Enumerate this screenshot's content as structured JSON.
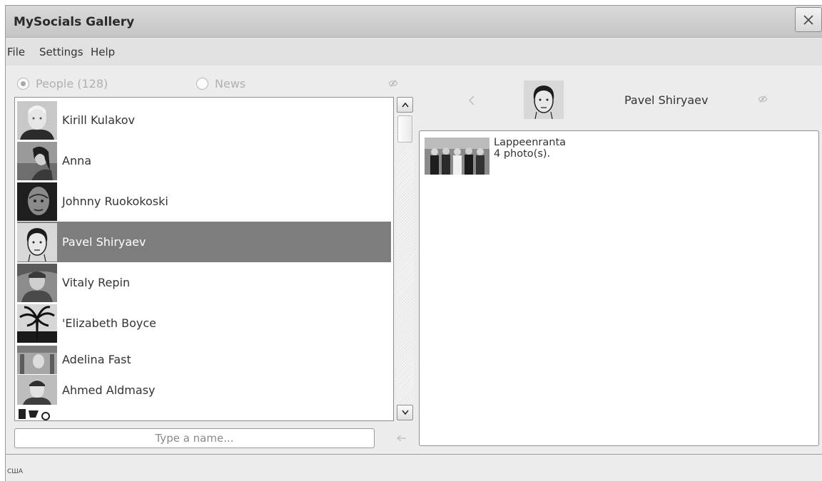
{
  "window": {
    "title": "MySocials Gallery"
  },
  "menu": {
    "file": "File",
    "settings": "Settings",
    "help": "Help"
  },
  "tabs": {
    "people": "People (128)",
    "news": "News",
    "selected": "people"
  },
  "people": [
    {
      "name": "Kirill Kulakov"
    },
    {
      "name": "Anna"
    },
    {
      "name": "Johnny Ruokokoski"
    },
    {
      "name": "Pavel Shiryaev",
      "selected": true
    },
    {
      "name": "Vitaly Repin"
    },
    {
      "name": "'Elizabeth Boyce"
    },
    {
      "name": "Adelina Fast"
    },
    {
      "name": "Ahmed Aldmasy"
    }
  ],
  "search": {
    "placeholder": "Type a name..."
  },
  "detail": {
    "name": "Pavel Shiryaev",
    "albums": [
      {
        "title": "Lappeenranta",
        "count": "4 photo(s)."
      }
    ]
  },
  "status": {
    "text": "США"
  },
  "colors": {
    "selected_row": "#7d7d7d",
    "titlebar": "#cfcfcf",
    "background": "#ececec"
  }
}
